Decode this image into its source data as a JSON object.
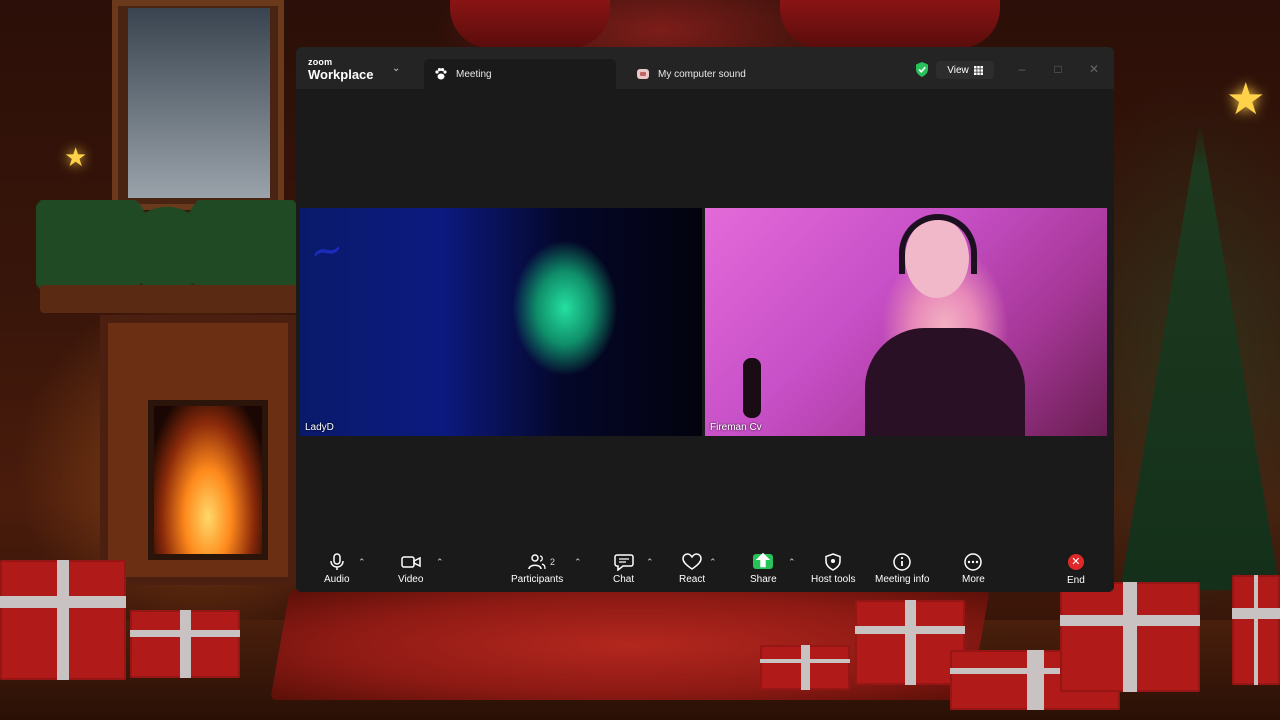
{
  "app": {
    "brand_small": "zoom",
    "brand_name": "Workplace"
  },
  "tabs": [
    {
      "label": "Meeting",
      "icon": "paw-icon"
    },
    {
      "label": "My computer sound",
      "icon": "speaker-icon"
    }
  ],
  "header": {
    "view_label": "View",
    "security_status_color": "#27c25a"
  },
  "participants": [
    {
      "name": "LadyD"
    },
    {
      "name": "Fireman Cv"
    }
  ],
  "toolbar": {
    "audio": "Audio",
    "video": "Video",
    "participants": "Participants",
    "participant_count": "2",
    "chat": "Chat",
    "react": "React",
    "share": "Share",
    "host_tools": "Host tools",
    "meeting_info": "Meeting info",
    "more": "More",
    "end": "End"
  },
  "colors": {
    "share_green": "#27c25a",
    "end_red": "#e02828"
  }
}
